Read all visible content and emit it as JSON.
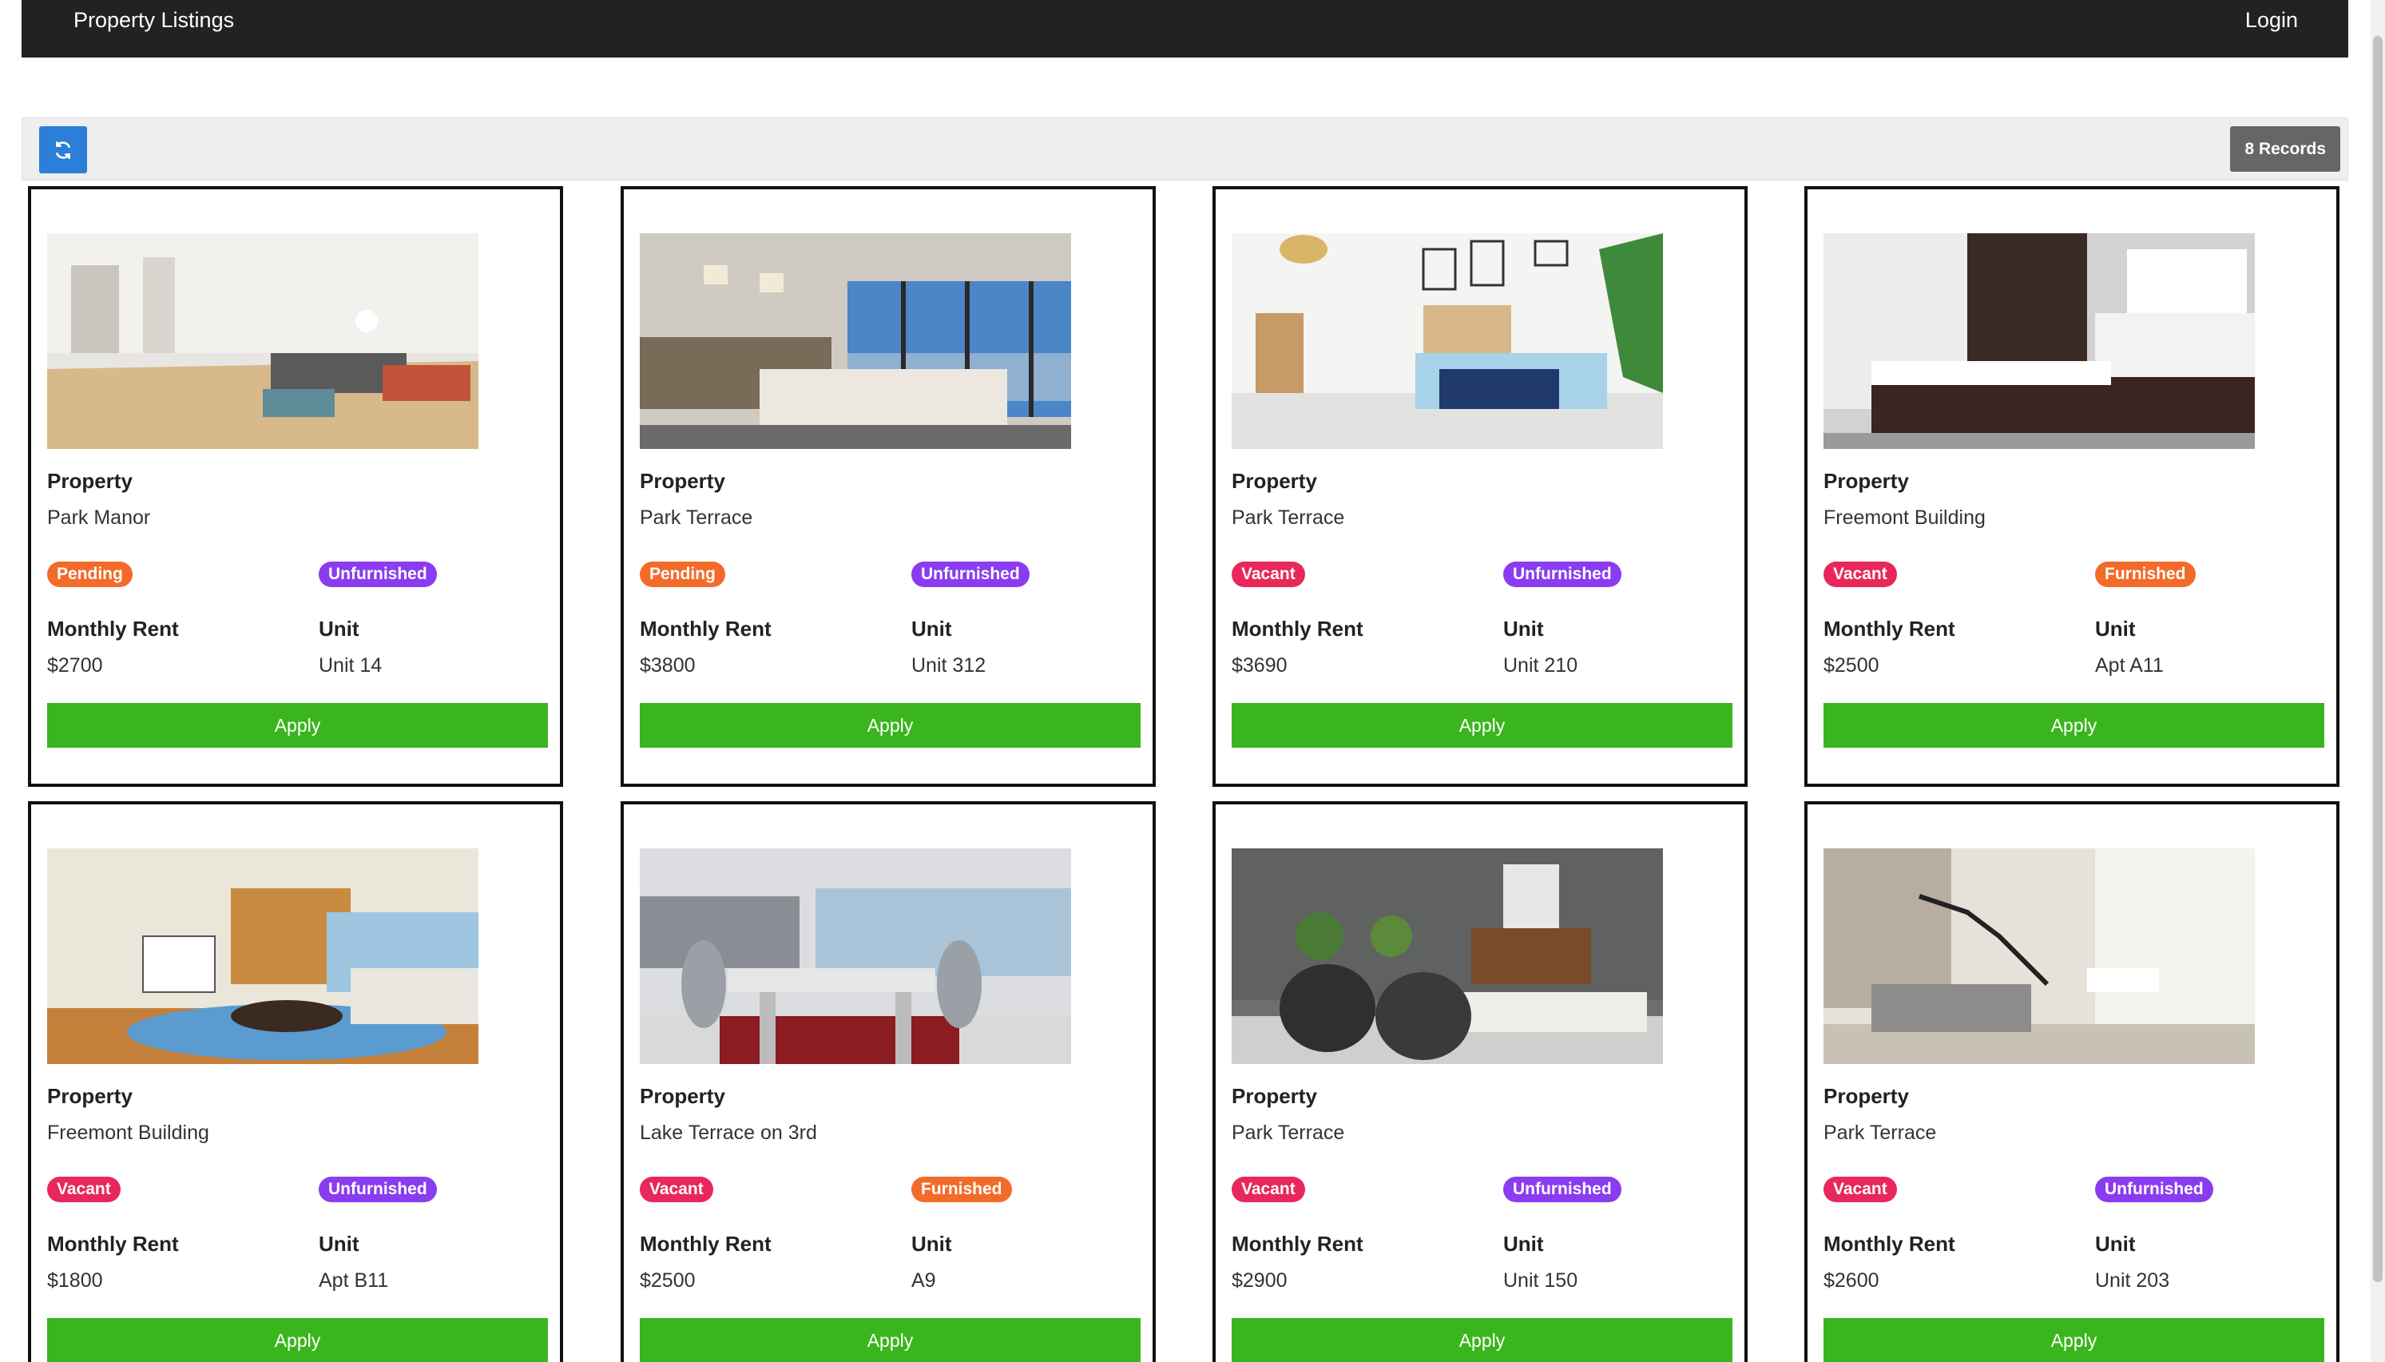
{
  "nav": {
    "brand": "Property Listings",
    "login": "Login"
  },
  "toolbar": {
    "records": "8 Records"
  },
  "labels": {
    "property": "Property",
    "monthly_rent": "Monthly Rent",
    "unit": "Unit",
    "apply": "Apply"
  },
  "colors": {
    "pending": "#f26b2a",
    "vacant": "#e8275a",
    "unfurnished": "#8a3cf0",
    "furnished": "#f26b2a",
    "apply": "#3bb51d",
    "refresh": "#2b7fd8"
  },
  "listings": [
    {
      "property": "Park Manor",
      "status": "Pending",
      "furnishing": "Unfurnished",
      "rent": "$2700",
      "unit": "Unit 14"
    },
    {
      "property": "Park Terrace",
      "status": "Pending",
      "furnishing": "Unfurnished",
      "rent": "$3800",
      "unit": "Unit 312"
    },
    {
      "property": "Park Terrace",
      "status": "Vacant",
      "furnishing": "Unfurnished",
      "rent": "$3690",
      "unit": "Unit 210"
    },
    {
      "property": "Freemont Building",
      "status": "Vacant",
      "furnishing": "Furnished",
      "rent": "$2500",
      "unit": "Apt A11"
    },
    {
      "property": "Freemont Building",
      "status": "Vacant",
      "furnishing": "Unfurnished",
      "rent": "$1800",
      "unit": "Apt B11"
    },
    {
      "property": "Lake Terrace on 3rd",
      "status": "Vacant",
      "furnishing": "Furnished",
      "rent": "$2500",
      "unit": "A9"
    },
    {
      "property": "Park Terrace",
      "status": "Vacant",
      "furnishing": "Unfurnished",
      "rent": "$2900",
      "unit": "Unit 150"
    },
    {
      "property": "Park Terrace",
      "status": "Vacant",
      "furnishing": "Unfurnished",
      "rent": "$2600",
      "unit": "Unit 203"
    }
  ]
}
